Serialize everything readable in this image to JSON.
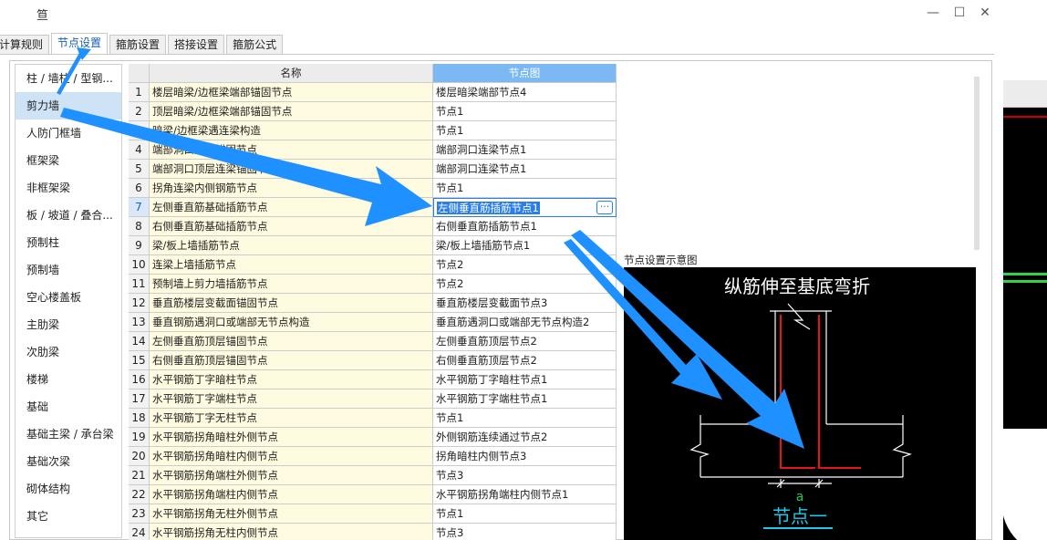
{
  "window": {
    "title_glyph": "笪",
    "minimize": "—",
    "maximize": "☐",
    "close": "✕"
  },
  "tabs": [
    "计算规则",
    "节点设置",
    "箍筋设置",
    "搭接设置",
    "箍筋公式"
  ],
  "sidebar": {
    "items": [
      "柱 / 墙柱 / 型钢...",
      "剪力墙",
      "人防门框墙",
      "框架梁",
      "非框架梁",
      "板 / 坡道 / 叠合...",
      "预制柱",
      "预制墙",
      "空心楼盖板",
      "主肋梁",
      "次肋梁",
      "楼梯",
      "基础",
      "基础主梁 / 承台梁",
      "基础次梁",
      "砌体结构",
      "其它"
    ]
  },
  "grid": {
    "headers": {
      "name": "名称",
      "node": "节点图"
    },
    "rows": [
      {
        "num": "1",
        "name": "楼层暗梁/边框梁端部锚固节点",
        "node": "楼层暗梁端部节点4"
      },
      {
        "num": "2",
        "name": "顶层暗梁/边框梁端部锚固节点",
        "node": "节点1"
      },
      {
        "num": "3",
        "name": "暗梁/边框梁遇连梁构造",
        "node": "节点1"
      },
      {
        "num": "4",
        "name": "端部洞口连梁锚固节点",
        "node": "端部洞口连梁节点1"
      },
      {
        "num": "5",
        "name": "端部洞口顶层连梁锚固节点",
        "node": "端部洞口连梁节点1"
      },
      {
        "num": "6",
        "name": "拐角连梁内侧钢筋节点",
        "node": "节点1"
      },
      {
        "num": "7",
        "name": "左侧垂直筋基础插筋节点",
        "node": "左侧垂直筋插筋节点1"
      },
      {
        "num": "8",
        "name": "右侧垂直筋基础插筋节点",
        "node": "右侧垂直筋插筋节点1"
      },
      {
        "num": "9",
        "name": "梁/板上墙插筋节点",
        "node": "梁/板上墙插筋节点1"
      },
      {
        "num": "10",
        "name": "连梁上墙插筋节点",
        "node": "节点2"
      },
      {
        "num": "11",
        "name": "预制墙上剪力墙插筋节点",
        "node": "节点2"
      },
      {
        "num": "12",
        "name": "垂直筋楼层变截面锚固节点",
        "node": "垂直筋楼层变截面节点3"
      },
      {
        "num": "13",
        "name": "垂直钢筋遇洞口或端部无节点构造",
        "node": "垂直筋遇洞口或端部无节点构造2"
      },
      {
        "num": "14",
        "name": "左侧垂直筋顶层锚固节点",
        "node": "左侧垂直筋顶层节点2"
      },
      {
        "num": "15",
        "name": "右侧垂直筋顶层锚固节点",
        "node": "右侧垂直筋顶层节点2"
      },
      {
        "num": "16",
        "name": "水平钢筋丁字暗柱节点",
        "node": "水平钢筋丁字暗柱节点1"
      },
      {
        "num": "17",
        "name": "水平钢筋丁字端柱节点",
        "node": "水平钢筋丁字端柱节点1"
      },
      {
        "num": "18",
        "name": "水平钢筋丁字无柱节点",
        "node": "节点1"
      },
      {
        "num": "19",
        "name": "水平钢筋拐角暗柱外侧节点",
        "node": "外侧钢筋连续通过节点2"
      },
      {
        "num": "20",
        "name": "水平钢筋拐角暗柱内侧节点",
        "node": "拐角暗柱内侧节点3"
      },
      {
        "num": "21",
        "name": "水平钢筋拐角端柱外侧节点",
        "node": "节点3"
      },
      {
        "num": "22",
        "name": "水平钢筋拐角端柱内侧节点",
        "node": "水平钢筋拐角端柱内侧节点1"
      },
      {
        "num": "23",
        "name": "水平钢筋拐角无柱外侧节点",
        "node": "节点1"
      },
      {
        "num": "24",
        "name": "水平钢筋拐角无柱内侧节点",
        "node": "节点3"
      }
    ],
    "ellipsis": "···"
  },
  "preview": {
    "label": "节点设置示意图",
    "title": "纵筋伸至基底弯折",
    "dim_label": "a",
    "caption": "节点一"
  },
  "colors": {
    "accent": "#2b7de9",
    "header_node_bg": "#7cb8f2",
    "name_col_bg": "#fffbe0",
    "sidebar_active": "#cfe3f7",
    "arrow": "#1e90ff",
    "rebar_red": "#e8141b",
    "dim_green": "#22c55e",
    "caption_cyan": "#1ec8e6"
  }
}
